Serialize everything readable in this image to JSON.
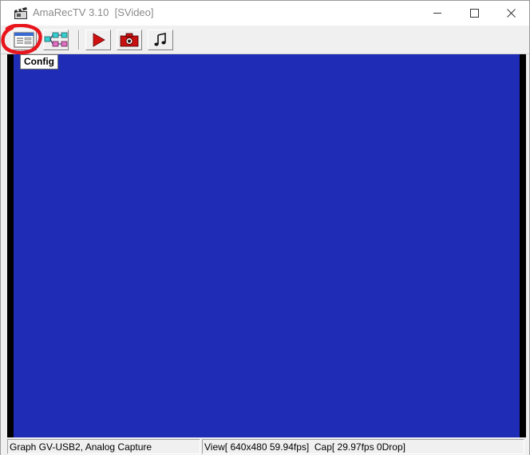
{
  "window": {
    "title": "AmaRecTV 3.10  [SVideo]"
  },
  "title_bar": {
    "app_icon": "clapperboard-icon",
    "minimize_icon": "minimize-icon",
    "maximize_icon": "maximize-icon",
    "close_icon": "close-icon"
  },
  "toolbar": {
    "buttons": [
      {
        "name": "config",
        "icon": "config-window-icon"
      },
      {
        "name": "graph",
        "icon": "filter-graph-icon"
      },
      {
        "name": "record",
        "icon": "play-record-icon"
      },
      {
        "name": "snapshot",
        "icon": "camera-icon"
      },
      {
        "name": "audio",
        "icon": "music-note-icon"
      }
    ]
  },
  "tooltip": {
    "text": "Config"
  },
  "video": {
    "background_color": "#1f2cb6"
  },
  "status_bar": {
    "device": "Graph GV-USB2, Analog Capture",
    "stats": "View[ 640x480 59.94fps]  Cap[ 29.97fps 0Drop]"
  },
  "colors": {
    "highlight": "#e8151c"
  }
}
